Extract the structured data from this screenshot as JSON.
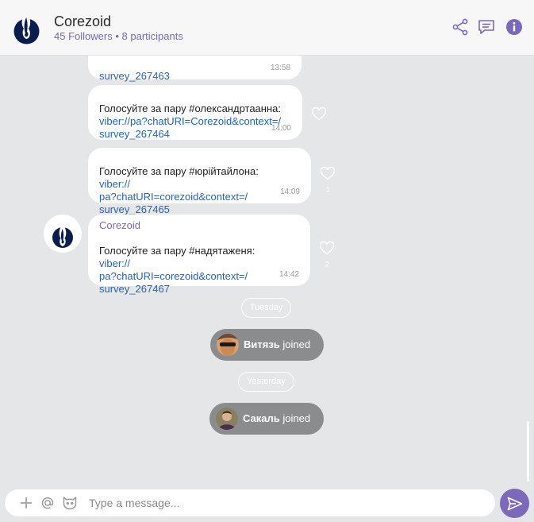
{
  "channel": {
    "name": "Corezoid",
    "followers": "45 Followers",
    "separator": "•",
    "participants": "8 participants"
  },
  "header_icons": [
    "share-icon",
    "chat-bubble-icon",
    "info-icon"
  ],
  "messages": [
    {
      "text": "",
      "link": "survey_267463",
      "time": "13:58"
    },
    {
      "text": "Голосуйте за пару #олександртаанна:",
      "link": "viber://pa?chatURI=Corezoid&context=/\nsurvey_267464",
      "time": "14:00",
      "likes": ""
    },
    {
      "text": "Голосуйте за пару #юрійтайлона:",
      "link": "viber://\npa?chatURI=corezoid&context=/\nsurvey_267465",
      "time": "14:09",
      "likes": "1"
    },
    {
      "sender": "Corezoid",
      "text": "Голосуйте за пару #надятаженя:",
      "link": "viber://\npa?chatURI=corezoid&context=/\nsurvey_267467",
      "time": "14:42",
      "likes": "2"
    }
  ],
  "dates": [
    "Tuesday",
    "Yesterday"
  ],
  "joins": [
    {
      "name": "Витязь",
      "action": "joined"
    },
    {
      "name": "Сакаль",
      "action": "joined"
    }
  ],
  "composer": {
    "placeholder": "Type a message...",
    "icons": [
      "plus-icon",
      "at-icon",
      "sticker-icon",
      "send-icon"
    ]
  },
  "colors": {
    "accent": "#7c69bc",
    "link": "#2563b7",
    "background": "#e5e6e7"
  }
}
